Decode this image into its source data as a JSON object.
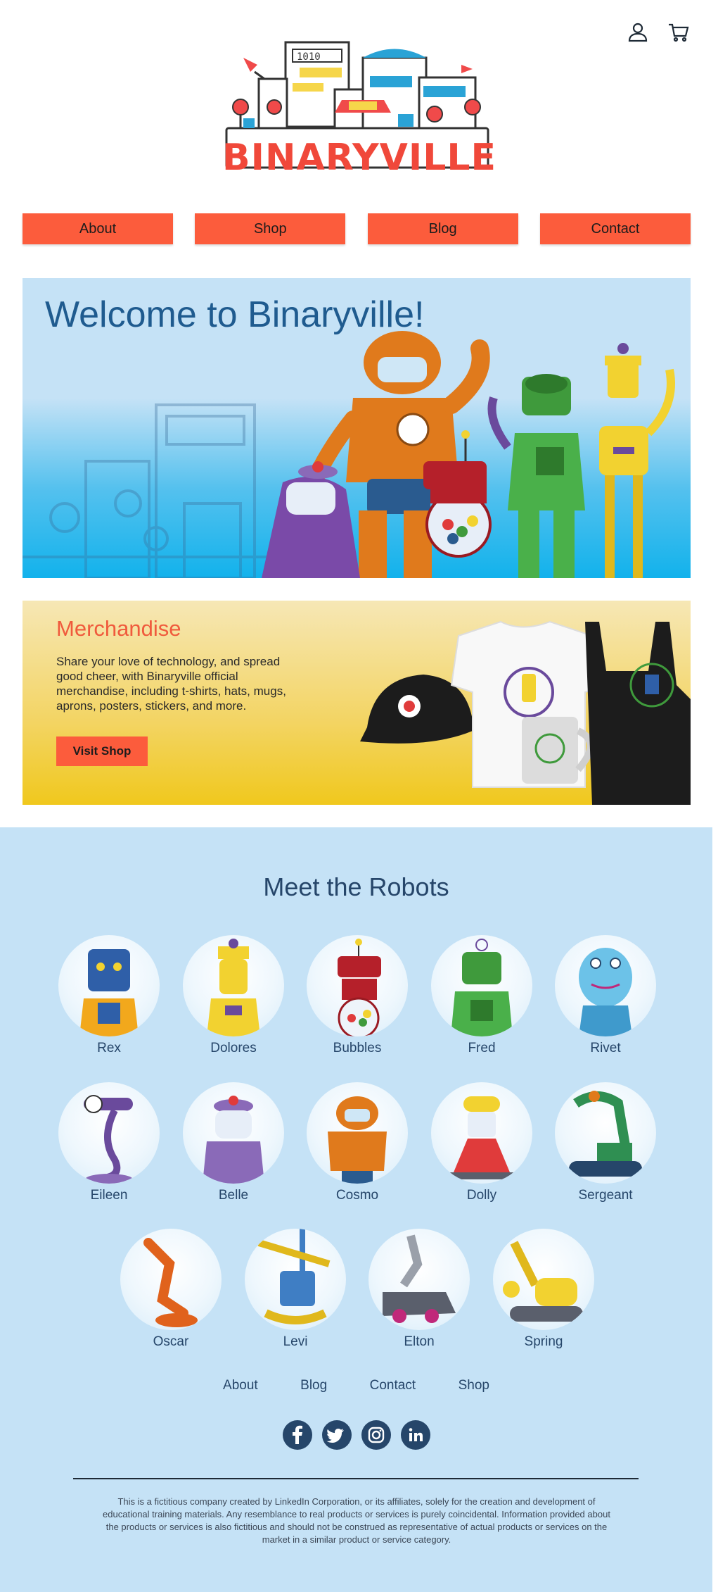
{
  "header": {
    "logo_text": "BINARYVILLE",
    "logo_house_sign": "1010",
    "icons": [
      "user-icon",
      "cart-icon"
    ]
  },
  "nav": [
    {
      "label": "About"
    },
    {
      "label": "Shop"
    },
    {
      "label": "Blog"
    },
    {
      "label": "Contact"
    }
  ],
  "hero": {
    "title": "Welcome to Binaryville!"
  },
  "merch": {
    "title": "Merchandise",
    "description": "Share your love of technology, and spread good cheer, with Binaryville official merchandise, including t-shirts, hats, mugs, aprons, posters, stickers, and more.",
    "button": "Visit Shop"
  },
  "robots": {
    "title": "Meet the Robots",
    "items": [
      {
        "name": "Rex",
        "color": "#2f5fa8"
      },
      {
        "name": "Dolores",
        "color": "#f2d230"
      },
      {
        "name": "Bubbles",
        "color": "#b5202a"
      },
      {
        "name": "Fred",
        "color": "#3f9a3c"
      },
      {
        "name": "Rivet",
        "color": "#6cc2e8"
      },
      {
        "name": "Eileen",
        "color": "#6a4a9c"
      },
      {
        "name": "Belle",
        "color": "#8a6ab8"
      },
      {
        "name": "Cosmo",
        "color": "#e07a1c"
      },
      {
        "name": "Dolly",
        "color": "#e03b3b"
      },
      {
        "name": "Sergeant",
        "color": "#2f8f52"
      },
      {
        "name": "Oscar",
        "color": "#e0621c"
      },
      {
        "name": "Levi",
        "color": "#3f7ec4"
      },
      {
        "name": "Elton",
        "color": "#5a5f6c"
      },
      {
        "name": "Spring",
        "color": "#f2d230"
      }
    ]
  },
  "footer": {
    "nav": [
      {
        "label": "About"
      },
      {
        "label": "Blog"
      },
      {
        "label": "Contact"
      },
      {
        "label": "Shop"
      }
    ],
    "social": [
      "facebook-icon",
      "twitter-icon",
      "instagram-icon",
      "linkedin-icon"
    ],
    "disclaimer": "This is a fictitious company created by LinkedIn Corporation, or its affiliates, solely for the creation and development of educational training materials. Any resemblance to real products or services is purely coincidental. Information provided about the products or services is also fictitious and should not be construed as representative of actual products or services on the market in a similar product or service category."
  },
  "colors": {
    "accent": "#fc5c3c",
    "navy": "#26466a",
    "sky": "#c5e2f6"
  }
}
